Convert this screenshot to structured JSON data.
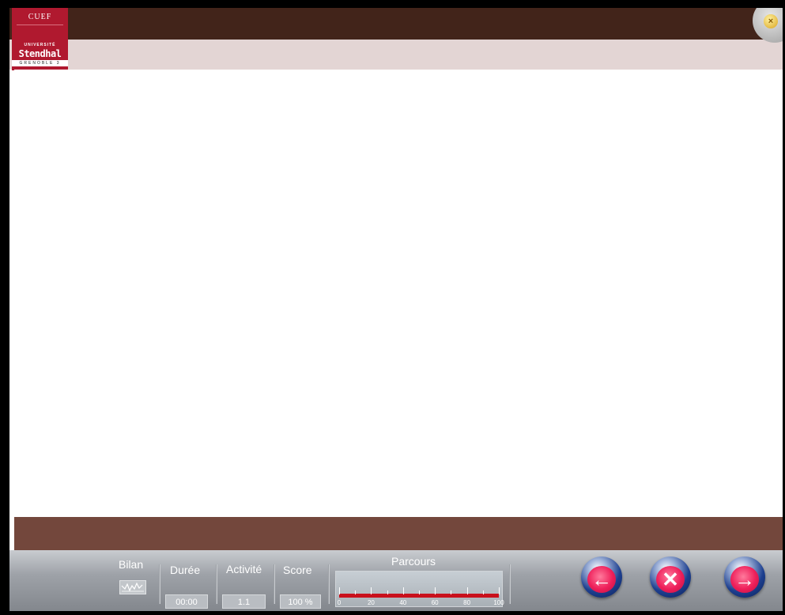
{
  "logo": {
    "line1": "CUEF",
    "line2": "UNIVERSITÉ",
    "line3": "Stendhal",
    "line4": "GRENOBLE 3"
  },
  "toolbar": {
    "bilan": {
      "label": "Bilan",
      "icon": "chart-line-icon"
    },
    "duree": {
      "label": "Durée",
      "value": "00:00"
    },
    "activite": {
      "label": "Activité",
      "value": "1.1"
    },
    "score": {
      "label": "Score",
      "value": "100 %"
    },
    "parcours": {
      "label": "Parcours",
      "progress_percent": 100,
      "scale": [
        "0",
        "20",
        "40",
        "60",
        "80",
        "100"
      ]
    },
    "buttons": [
      {
        "name": "previous-button",
        "icon": "arrow-left-icon"
      },
      {
        "name": "cancel-button",
        "icon": "x-icon"
      },
      {
        "name": "next-button",
        "icon": "arrow-right-icon"
      }
    ]
  },
  "colors": {
    "header": "#42241a",
    "subheader": "#e3d5d4",
    "logo": "#b0192f",
    "footer_band": "#73473c",
    "progress": "#c9101c",
    "button_core": "#ee1f5a",
    "button_ring": "#1d3f8f"
  }
}
